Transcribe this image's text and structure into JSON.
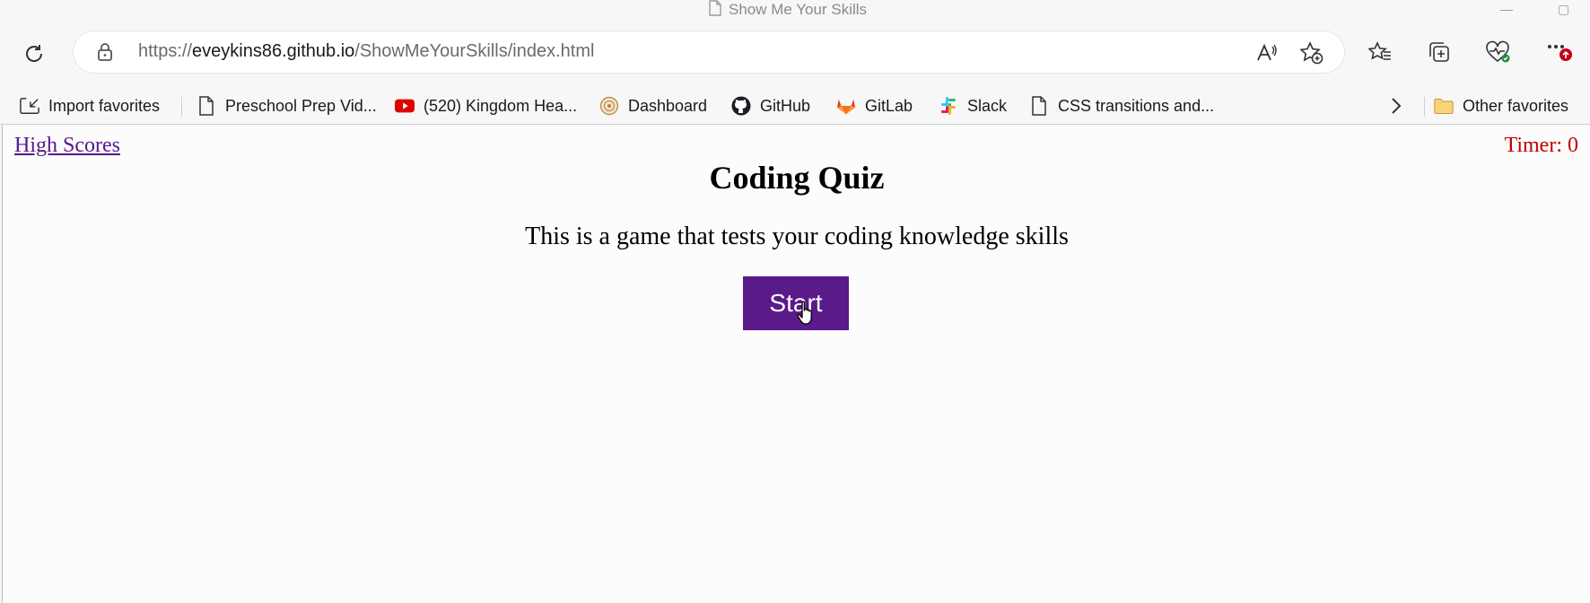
{
  "window": {
    "title": "Show Me Your Skills"
  },
  "address_bar": {
    "url_prefix": "https://",
    "url_host": "eveykins86.github.io",
    "url_path": "/ShowMeYourSkills/index.html"
  },
  "bookmarks": [
    {
      "label": "Import favorites",
      "icon": "import-icon"
    },
    {
      "label": "Preschool Prep Vid...",
      "icon": "page-icon"
    },
    {
      "label": "(520) Kingdom Hea...",
      "icon": "youtube-icon"
    },
    {
      "label": "Dashboard",
      "icon": "dashboard-site-icon"
    },
    {
      "label": "GitHub",
      "icon": "github-icon"
    },
    {
      "label": "GitLab",
      "icon": "gitlab-icon"
    },
    {
      "label": "Slack",
      "icon": "slack-icon"
    },
    {
      "label": "CSS transitions and...",
      "icon": "page-icon"
    }
  ],
  "other_favorites": "Other favorites",
  "page": {
    "high_scores_link": "High Scores",
    "timer": "Timer: 0",
    "title": "Coding Quiz",
    "description": "This is a game that tests your coding knowledge skills",
    "start_button": "Start"
  },
  "colors": {
    "start_button_bg": "#5a1a8a",
    "timer_color": "#c00000",
    "link_color": "#551a8b"
  }
}
